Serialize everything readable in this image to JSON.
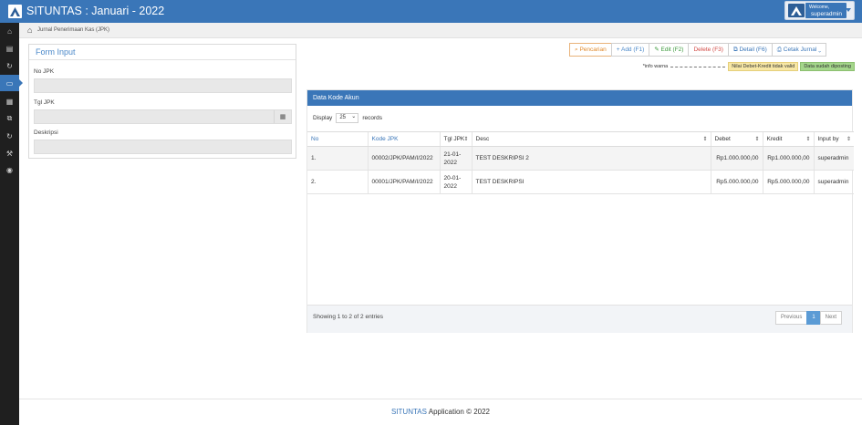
{
  "header": {
    "title": "SITUNTAS : Januari - 2022",
    "user": {
      "welcome": "Welcome,",
      "name": "superadmin"
    }
  },
  "sidebar": {
    "items": [
      {
        "icon": "home-icon",
        "glyph": "⌂"
      },
      {
        "icon": "clipboard-icon",
        "glyph": "▤"
      },
      {
        "icon": "refresh-icon",
        "glyph": "↻"
      },
      {
        "icon": "money-icon",
        "glyph": "▭"
      },
      {
        "icon": "calculator-icon",
        "glyph": "▦"
      },
      {
        "icon": "copy-icon",
        "glyph": "⧉"
      },
      {
        "icon": "sync-icon",
        "glyph": "↻"
      },
      {
        "icon": "wrench-icon",
        "glyph": "⚒"
      },
      {
        "icon": "circle-arrow-icon",
        "glyph": "◉"
      }
    ]
  },
  "breadcrumb": {
    "text": "Jurnal Penerimaan Kas (JPK)"
  },
  "form": {
    "title": "Form Input",
    "fields": {
      "no_jpk": {
        "label": "No JPK",
        "value": ""
      },
      "tgl_jpk": {
        "label": "Tgl JPK",
        "value": ""
      },
      "deskripsi": {
        "label": "Deskripsi",
        "value": ""
      }
    }
  },
  "toolbar": {
    "search": "Pencarian",
    "add": "+ Add (F1)",
    "edit": "Edit (F2)",
    "delete": "Delete (F3)",
    "detail": "Detail (F6)",
    "print": "Cetak Jurnal"
  },
  "info": {
    "label": "*info warna",
    "invalid": "Nilai Debet-Kredit tidak valid",
    "posted": "Data sudah diposting"
  },
  "table": {
    "title": "Data Kode Akun",
    "display_label": "Display",
    "display_value": "25",
    "records_label": "records",
    "columns": [
      "No",
      "Kode JPK",
      "Tgl JPK",
      "Desc",
      "Debet",
      "Kredit",
      "Input by"
    ],
    "rows": [
      {
        "no": "1.",
        "kode": "00002/JPK/PAM/I/2022",
        "tgl": "21-01-2022",
        "desc": "TEST DESKRIPSI 2",
        "debet": "Rp1.000.000,00",
        "kredit": "Rp1.000.000,00",
        "input_by": "superadmin"
      },
      {
        "no": "2.",
        "kode": "00001/JPK/PAM/I/2022",
        "tgl": "20-01-2022",
        "desc": "TEST DESKRIPSI",
        "debet": "Rp5.000.000,00",
        "kredit": "Rp5.000.000,00",
        "input_by": "superadmin"
      }
    ],
    "showing": "Showing 1 to 2 of 2 entries",
    "pager": {
      "previous": "Previous",
      "page": "1",
      "next": "Next"
    }
  },
  "footer": {
    "brand": "SITUNTAS",
    "text": "Application © 2022"
  },
  "colors": {
    "primary": "#3a76b8",
    "sidebar": "#1f1f1f",
    "search": "#e08a2c",
    "edit": "#3d9a3d",
    "delete": "#d24b46"
  }
}
